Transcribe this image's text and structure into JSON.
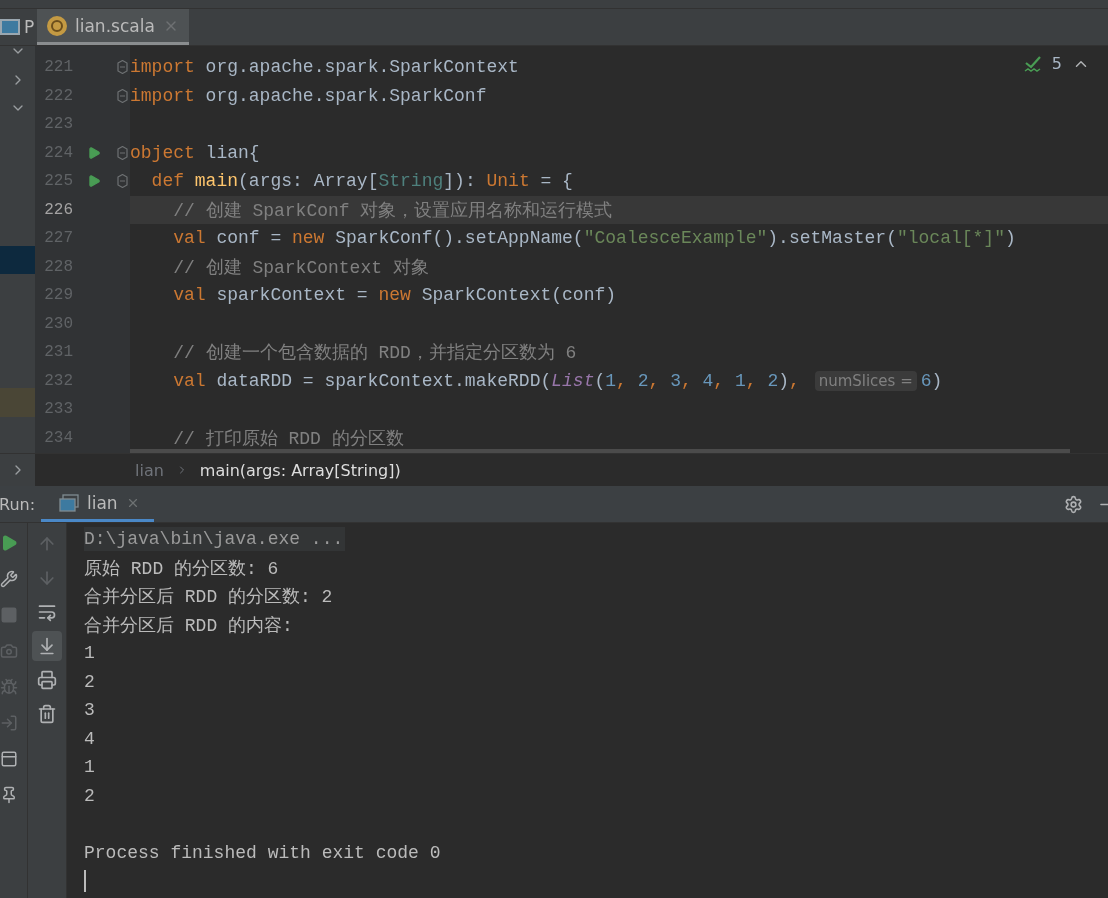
{
  "project_panel": {
    "title": "P",
    "rows": [
      {
        "kind": "expanded"
      },
      {
        "kind": "collapsed"
      },
      {
        "kind": "expanded"
      },
      {
        "kind": "plain"
      },
      {
        "kind": "plain"
      },
      {
        "kind": "plain"
      },
      {
        "kind": "plain"
      },
      {
        "kind": "selected"
      },
      {
        "kind": "plain"
      },
      {
        "kind": "plain"
      },
      {
        "kind": "plain"
      },
      {
        "kind": "plain"
      },
      {
        "kind": "marked"
      }
    ],
    "footer_expanded": false
  },
  "editor_tabs": [
    {
      "label": "lian.scala",
      "selected": true
    }
  ],
  "inspection": {
    "count": "5"
  },
  "lines": [
    {
      "number": "221",
      "run_marker": false,
      "fold_marker": true,
      "tokens": [
        {
          "kind": "keyword",
          "text": "import"
        },
        {
          "kind": "plain",
          "text": " org.apache.spark.SparkContext"
        }
      ]
    },
    {
      "number": "222",
      "run_marker": false,
      "fold_marker": true,
      "tokens": [
        {
          "kind": "keyword",
          "text": "import"
        },
        {
          "kind": "plain",
          "text": " org.apache.spark.SparkConf"
        }
      ]
    },
    {
      "number": "223",
      "run_marker": false,
      "fold_marker": false
    },
    {
      "number": "224",
      "run_marker": true,
      "fold_marker": true,
      "tokens": [
        {
          "kind": "keyword",
          "text": "object"
        },
        {
          "kind": "plain",
          "text": " lian{"
        }
      ],
      "children": [
        {
          "number": "225",
          "run_marker": true,
          "fold_marker": true,
          "tokens": [
            {
              "kind": "keyword",
              "text": "def "
            },
            {
              "kind": "function",
              "text": "main"
            },
            {
              "kind": "plain",
              "text": "(args: Array["
            },
            {
              "kind": "type",
              "text": "String"
            },
            {
              "kind": "plain",
              "text": "]): "
            },
            {
              "kind": "keyword",
              "text": "Unit"
            },
            {
              "kind": "plain",
              "text": " = {"
            }
          ],
          "children": [
            {
              "number": "226",
              "current": true,
              "run_marker": false,
              "fold_marker": false,
              "tokens": [
                {
                  "kind": "comment",
                  "text": "// 创建 SparkConf 对象，设置应用名称和运行模式"
                }
              ]
            },
            {
              "number": "227",
              "run_marker": false,
              "fold_marker": false,
              "tokens": [
                {
                  "kind": "keyword",
                  "text": "val"
                },
                {
                  "kind": "plain",
                  "text": " conf = "
                },
                {
                  "kind": "keyword",
                  "text": "new"
                },
                {
                  "kind": "plain",
                  "text": " SparkConf().setAppName("
                },
                {
                  "kind": "string",
                  "text": "\"CoalesceExample\""
                },
                {
                  "kind": "plain",
                  "text": ").setMaster("
                },
                {
                  "kind": "string",
                  "text": "\"local[*]\""
                },
                {
                  "kind": "plain",
                  "text": ")"
                }
              ]
            },
            {
              "number": "228",
              "run_marker": false,
              "fold_marker": false,
              "tokens": [
                {
                  "kind": "comment",
                  "text": "// 创建 SparkContext 对象"
                }
              ]
            },
            {
              "number": "229",
              "run_marker": false,
              "fold_marker": false,
              "tokens": [
                {
                  "kind": "keyword",
                  "text": "val"
                },
                {
                  "kind": "plain",
                  "text": " sparkContext = "
                },
                {
                  "kind": "keyword",
                  "text": "new"
                },
                {
                  "kind": "plain",
                  "text": " SparkContext(conf)"
                }
              ]
            },
            {
              "number": "230",
              "run_marker": false,
              "fold_marker": false
            },
            {
              "number": "231",
              "run_marker": false,
              "fold_marker": false,
              "tokens": [
                {
                  "kind": "comment",
                  "text": "// 创建一个包含数据的 RDD，并指定分区数为 6"
                }
              ]
            },
            {
              "number": "232",
              "run_marker": false,
              "fold_marker": false,
              "tokens": [
                {
                  "kind": "keyword",
                  "text": "val"
                },
                {
                  "kind": "plain",
                  "text": " dataRDD = sparkContext.makeRDD("
                },
                {
                  "kind": "italic",
                  "text": "List"
                },
                {
                  "kind": "plain",
                  "text": "("
                },
                {
                  "kind": "number",
                  "text": "1"
                },
                {
                  "kind": "keyword",
                  "text": ", "
                },
                {
                  "kind": "number",
                  "text": "2"
                },
                {
                  "kind": "keyword",
                  "text": ", "
                },
                {
                  "kind": "number",
                  "text": "3"
                },
                {
                  "kind": "keyword",
                  "text": ", "
                },
                {
                  "kind": "number",
                  "text": "4"
                },
                {
                  "kind": "keyword",
                  "text": ", "
                },
                {
                  "kind": "number",
                  "text": "1"
                },
                {
                  "kind": "keyword",
                  "text": ", "
                },
                {
                  "kind": "number",
                  "text": "2"
                },
                {
                  "kind": "plain",
                  "text": ")"
                },
                {
                  "kind": "keyword",
                  "text": ", "
                },
                {
                  "kind": "hint",
                  "text": "numSlices ="
                },
                {
                  "kind": "number",
                  "text": "6"
                },
                {
                  "kind": "plain",
                  "text": ")"
                }
              ]
            },
            {
              "number": "233",
              "run_marker": false,
              "fold_marker": false
            },
            {
              "number": "234",
              "run_marker": false,
              "fold_marker": false,
              "tokens": [
                {
                  "kind": "comment",
                  "text": "// 打印原始 RDD 的分区数"
                }
              ]
            }
          ]
        }
      ]
    }
  ],
  "breadcrumbs": [
    {
      "label": "lian",
      "selected": false
    },
    {
      "label": "main(args: Array[String])",
      "selected": true
    }
  ],
  "run_panel": {
    "label": "Run:",
    "tabs": [
      {
        "label": "lian",
        "selected": true
      }
    ]
  },
  "run_tools": [
    {
      "kind": "rerun",
      "disabled": false
    },
    {
      "kind": "settings",
      "disabled": false
    },
    {
      "kind": "stop",
      "disabled": true
    },
    {
      "kind": "camera",
      "disabled": true
    },
    {
      "kind": "debug",
      "disabled": true
    },
    {
      "kind": "restore",
      "disabled": true
    },
    {
      "kind": "layout",
      "disabled": false
    },
    {
      "kind": "pin",
      "disabled": false
    }
  ],
  "console_tools": [
    {
      "kind": "up",
      "disabled": true,
      "selected": false
    },
    {
      "kind": "down",
      "disabled": true,
      "selected": false
    },
    {
      "kind": "wrap",
      "disabled": false,
      "selected": false
    },
    {
      "kind": "scroll-end",
      "disabled": false,
      "selected": true
    },
    {
      "kind": "print",
      "disabled": false,
      "selected": false
    },
    {
      "kind": "clear",
      "disabled": false,
      "selected": false
    }
  ],
  "console": [
    {
      "kind": "command",
      "text": "D:\\java\\bin\\java.exe ..."
    },
    {
      "kind": "output",
      "text": "原始 RDD 的分区数: 6"
    },
    {
      "kind": "output",
      "text": "合并分区后 RDD 的分区数: 2"
    },
    {
      "kind": "output",
      "text": "合并分区后 RDD 的内容:"
    },
    {
      "kind": "output",
      "text": "1"
    },
    {
      "kind": "output",
      "text": "2"
    },
    {
      "kind": "output",
      "text": "3"
    },
    {
      "kind": "output",
      "text": "4"
    },
    {
      "kind": "output",
      "text": "1"
    },
    {
      "kind": "output",
      "text": "2"
    },
    {
      "kind": "blank"
    },
    {
      "kind": "output",
      "text": "Process finished with exit code 0"
    },
    {
      "kind": "cursor"
    }
  ]
}
